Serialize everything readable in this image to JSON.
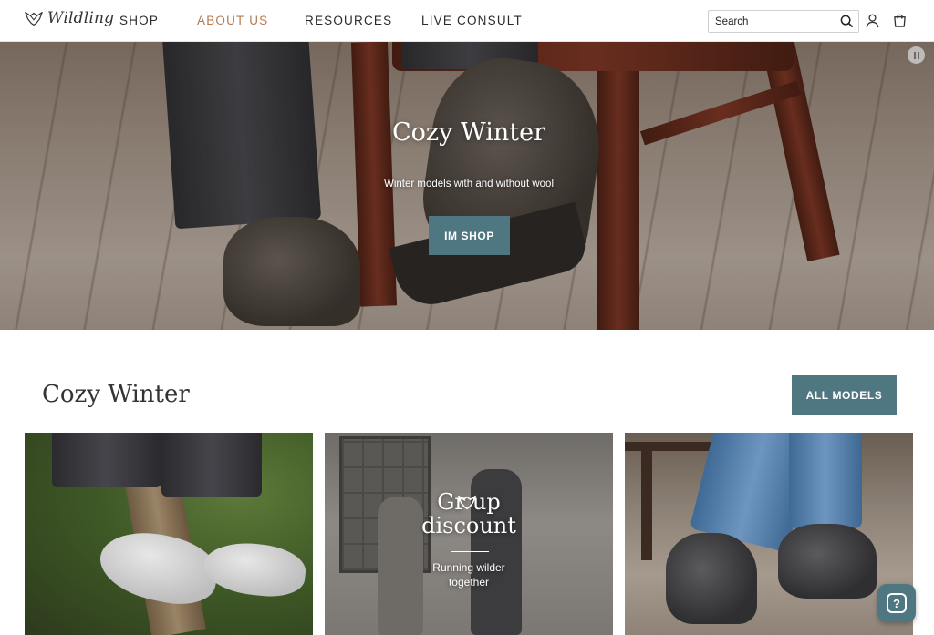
{
  "header": {
    "brand": "Wildling",
    "nav": [
      "SHOP",
      "ABOUT US",
      "RESOURCES",
      "LIVE CONSULT"
    ],
    "search_placeholder": "Search",
    "icons": {
      "search": "search-icon",
      "account": "account-icon",
      "cart": "cart-icon"
    }
  },
  "hero": {
    "title": "Cozy Winter",
    "subtitle": "Winter models with and without wool",
    "cta_label": "IM SHOP",
    "pause_icon": "pause-icon"
  },
  "section": {
    "title": "Cozy Winter",
    "button_label": "ALL MODELS"
  },
  "cards": {
    "group": {
      "title_line1": "Gr  up",
      "title_line2": "discount",
      "subtitle_line1": "Running wilder",
      "subtitle_line2": "together"
    }
  },
  "help": {
    "label": "?"
  },
  "colors": {
    "accent": "#4f7782",
    "nav_active": "#b47a52"
  }
}
